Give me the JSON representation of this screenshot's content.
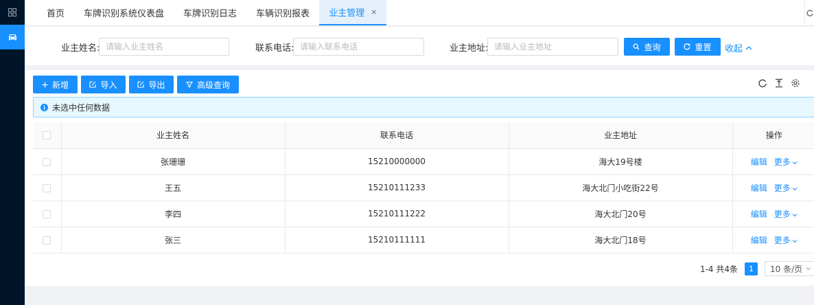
{
  "sidebar": {
    "items": [
      {
        "icon": "grid-icon",
        "active": false
      },
      {
        "icon": "car-icon",
        "active": true
      }
    ]
  },
  "tabs": {
    "items": [
      {
        "label": "首页",
        "active": false
      },
      {
        "label": "车牌识别系统仪表盘",
        "active": false
      },
      {
        "label": "车牌识别日志",
        "active": false
      },
      {
        "label": "车辆识别报表",
        "active": false
      },
      {
        "label": "业主管理",
        "active": true,
        "closable": true
      }
    ],
    "close_glyph": "×"
  },
  "search": {
    "fields": [
      {
        "label": "业主姓名:",
        "placeholder": "请输入业主姓名",
        "value": ""
      },
      {
        "label": "联系电话:",
        "placeholder": "请输入联系电话",
        "value": ""
      },
      {
        "label": "业主地址:",
        "placeholder": "请输入业主地址",
        "value": ""
      }
    ],
    "query_label": "查询",
    "reset_label": "重置",
    "collapse_label": "收起"
  },
  "toolbar": {
    "add_label": "新增",
    "import_label": "导入",
    "export_label": "导出",
    "advanced_label": "高级查询"
  },
  "alert": {
    "text": "未选中任何数据"
  },
  "table": {
    "columns": [
      "业主姓名",
      "联系电话",
      "业主地址",
      "操作"
    ],
    "rows": [
      {
        "name": "张珊珊",
        "phone": "15210000000",
        "address": "海大19号楼"
      },
      {
        "name": "王五",
        "phone": "15210111233",
        "address": "海大北门小吃街22号"
      },
      {
        "name": "李四",
        "phone": "15210111222",
        "address": "海大北门20号"
      },
      {
        "name": "张三",
        "phone": "15210111111",
        "address": "海大北门18号"
      }
    ],
    "edit_label": "编辑",
    "more_label": "更多"
  },
  "pagination": {
    "summary": "1-4 共4条",
    "current_page": "1",
    "page_size": "10 条/页"
  },
  "colors": {
    "primary": "#1890ff",
    "sidebar_bg": "#001529"
  }
}
